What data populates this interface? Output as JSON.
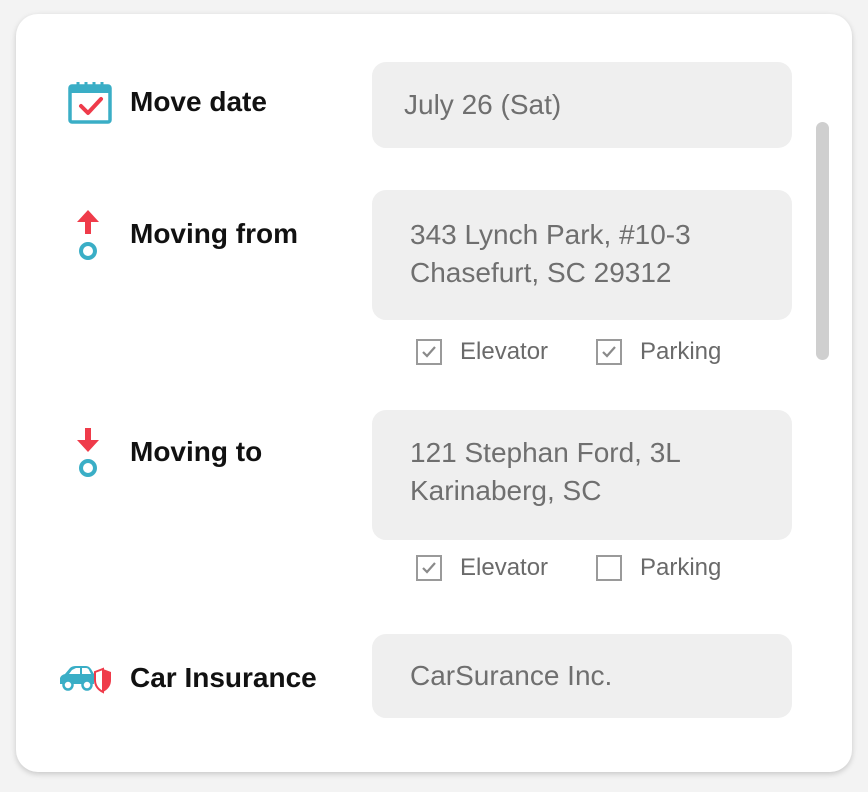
{
  "move_date": {
    "label": "Move date",
    "value": "July 26 (Sat)",
    "icon": "calendar-check-icon"
  },
  "moving_from": {
    "label": "Moving from",
    "address_line1": "343 Lynch Park, #10-3",
    "address_line2": "Chasefurt, SC 29312",
    "icon": "arrow-up-origin-icon",
    "elevator": {
      "label": "Elevator",
      "checked": true
    },
    "parking": {
      "label": "Parking",
      "checked": true
    }
  },
  "moving_to": {
    "label": "Moving to",
    "address_line1": "121 Stephan Ford, 3L",
    "address_line2": "Karinaberg, SC",
    "icon": "arrow-down-destination-icon",
    "elevator": {
      "label": "Elevator",
      "checked": true
    },
    "parking": {
      "label": "Parking",
      "checked": false
    }
  },
  "car_insurance": {
    "label": "Car Insurance",
    "value": "CarSurance Inc.",
    "icon": "car-shield-icon"
  },
  "colors": {
    "teal": "#3aaec6",
    "red": "#ef3b4a",
    "field_bg": "#efefef",
    "text_dark": "#111111",
    "text_muted": "#6f6f6f"
  }
}
